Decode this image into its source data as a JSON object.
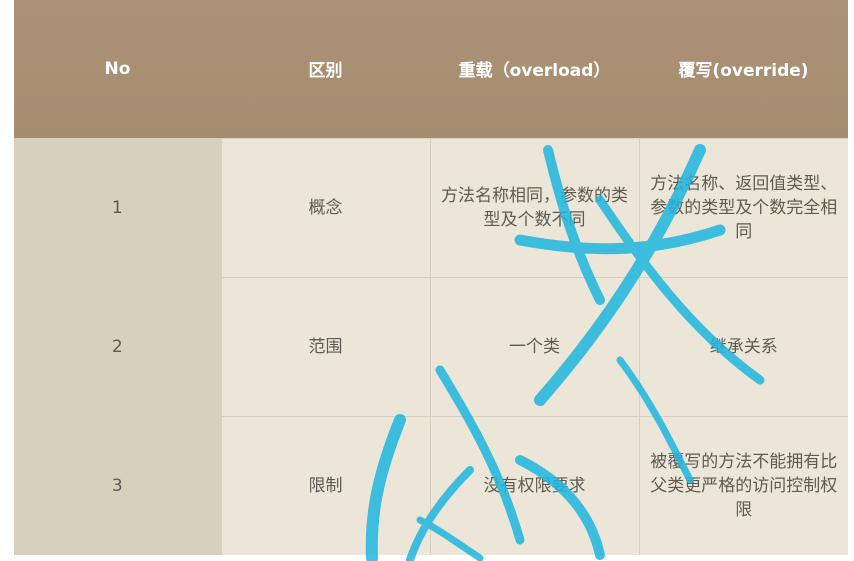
{
  "table": {
    "headers": [
      "No",
      "区别",
      "重载（overload）",
      "覆写(override)"
    ],
    "rows": [
      {
        "no": "1",
        "diff": "概念",
        "overload": "方法名称相同，参数的类型及个数不同",
        "override": "方法名称、返回值类型、参数的类型及个数完全相同"
      },
      {
        "no": "2",
        "diff": "范围",
        "overload": "一个类",
        "override": "继承关系"
      },
      {
        "no": "3",
        "diff": "限制",
        "overload": "没有权限要求",
        "override": "被覆写的方法不能拥有比父类更严格的访问控制权限"
      }
    ]
  },
  "colors": {
    "header_bg": "#a89073",
    "body_bg": "#ebe6d8",
    "no_col_bg": "#d6d0bd",
    "watermark": "#1fb6e0"
  }
}
